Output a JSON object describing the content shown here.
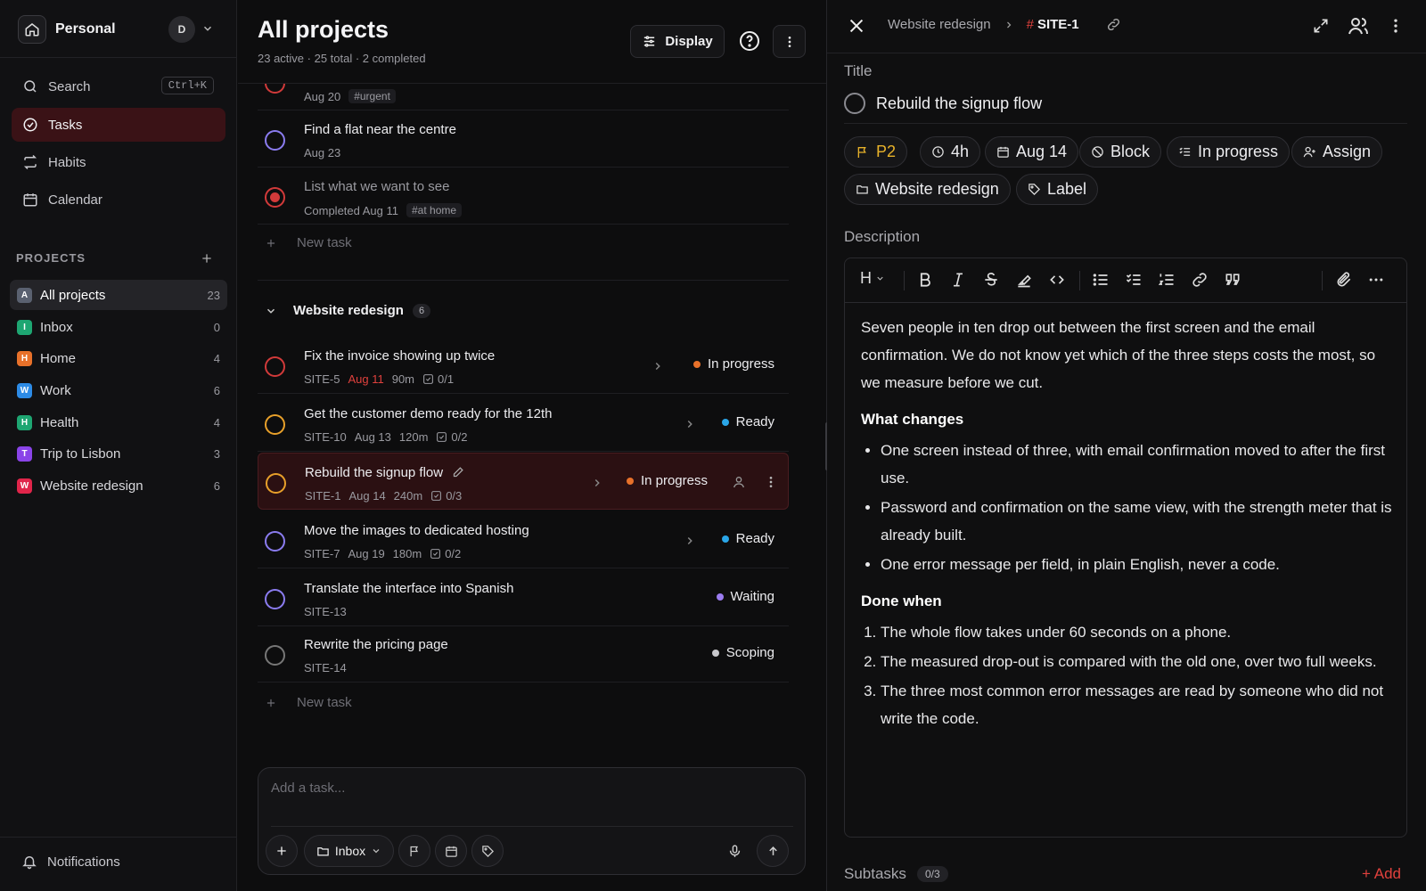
{
  "sidebar": {
    "workspace": "Personal",
    "avatar": "D",
    "search": {
      "label": "Search",
      "shortcut": "Ctrl+K"
    },
    "nav": [
      {
        "label": "Tasks",
        "icon": "check-circle-icon",
        "active": true
      },
      {
        "label": "Habits",
        "icon": "repeat-icon"
      },
      {
        "label": "Calendar",
        "icon": "calendar-icon"
      }
    ],
    "projects_heading": "PROJECTS",
    "projects": [
      {
        "letter": "A",
        "label": "All projects",
        "count": "23",
        "color": "#5a6170",
        "active": true
      },
      {
        "letter": "I",
        "label": "Inbox",
        "count": "0",
        "color": "#1ea672"
      },
      {
        "letter": "H",
        "label": "Home",
        "count": "4",
        "color": "#e8712a"
      },
      {
        "letter": "W",
        "label": "Work",
        "count": "6",
        "color": "#2d8be6"
      },
      {
        "letter": "H",
        "label": "Health",
        "count": "4",
        "color": "#1ea672"
      },
      {
        "letter": "T",
        "label": "Trip to Lisbon",
        "count": "3",
        "color": "#8a44e8"
      },
      {
        "letter": "W",
        "label": "Website redesign",
        "count": "6",
        "color": "#e0254a"
      }
    ],
    "notifications": "Notifications"
  },
  "main": {
    "title": "All projects",
    "subtitle": "23 active · 25 total · 2 completed",
    "display_label": "Display",
    "top_task": {
      "date": "Aug 20",
      "tag": "#urgent"
    },
    "tasks_before": [
      {
        "title": "Find a flat near the centre",
        "date": "Aug 23",
        "circle": "#8b7cf0"
      },
      {
        "title": "List what we want to see",
        "completed": "Completed Aug 11",
        "tag": "#at home",
        "circle": "#d23a3a"
      }
    ],
    "new_task": "New task",
    "group": {
      "name": "Website redesign",
      "count": "6"
    },
    "tasks": [
      {
        "title": "Fix the invoice showing up twice",
        "code": "SITE-5",
        "date": "Aug 11",
        "overdue": true,
        "duration": "90m",
        "subtasks": "0/1",
        "status": "In progress",
        "status_color": "#e8712a",
        "circle": "#d23a3a"
      },
      {
        "title": "Get the customer demo ready for the 12th",
        "code": "SITE-10",
        "date": "Aug 13",
        "duration": "120m",
        "subtasks": "0/2",
        "status": "Ready",
        "status_color": "#2aa6e8",
        "circle": "#e8a02a"
      },
      {
        "title": "Rebuild the signup flow",
        "code": "SITE-1",
        "date": "Aug 14",
        "duration": "240m",
        "subtasks": "0/3",
        "status": "In progress",
        "status_color": "#e8712a",
        "circle": "#e8a02a",
        "selected": true
      },
      {
        "title": "Move the images to dedicated hosting",
        "code": "SITE-7",
        "date": "Aug 19",
        "duration": "180m",
        "subtasks": "0/2",
        "status": "Ready",
        "status_color": "#2aa6e8",
        "circle": "#8b7cf0"
      },
      {
        "title": "Translate the interface into Spanish",
        "code": "SITE-13",
        "status": "Waiting",
        "status_color": "#9b7cf0",
        "circle": "#8b7cf0"
      },
      {
        "title": "Rewrite the pricing page",
        "code": "SITE-14",
        "status": "Scoping",
        "status_color": "#c8c8cc",
        "circle": "#777"
      }
    ],
    "composer": {
      "placeholder": "Add a task...",
      "project": "Inbox"
    }
  },
  "detail": {
    "breadcrumb_project": "Website redesign",
    "code": "SITE-1",
    "title_label": "Title",
    "title": "Rebuild the signup flow",
    "chips": {
      "priority": "P2",
      "priority_color": "#e8b22a",
      "estimate": "4h",
      "date": "Aug 14",
      "block": "Block",
      "status": "In progress",
      "assign": "Assign",
      "project": "Website redesign",
      "label": "Label"
    },
    "description_label": "Description",
    "description": {
      "intro": "Seven people in ten drop out between the first screen and the email confirmation. We do not know yet which of the three steps costs the most, so we measure before we cut.",
      "h1": "What changes",
      "bullets": [
        "One screen instead of three, with email confirmation moved to after the first use.",
        "Password and confirmation on the same view, with the strength meter that is already built.",
        "One error message per field, in plain English, never a code."
      ],
      "h2": "Done when",
      "numbered": [
        "The whole flow takes under 60 seconds on a phone.",
        "The measured drop-out is compared with the old one, over two full weeks.",
        "The three most common error messages are read by someone who did not write the code."
      ]
    },
    "subtasks_label": "Subtasks",
    "subtasks_count": "0/3",
    "add_label": "+ Add"
  }
}
